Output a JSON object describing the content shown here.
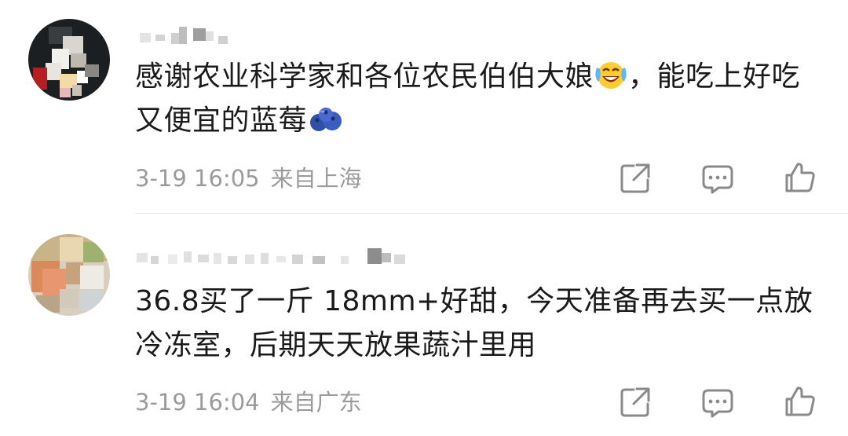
{
  "comments": [
    {
      "text_before_emoji": "感谢农业科学家和各位农民伯伯大娘",
      "emoji_1": "crying-laughing-emoji",
      "text_after_emoji": "，能吃上好吃又便宜的蓝莓",
      "emoji_2": "blueberry-emoji",
      "time": "3-19 16:05",
      "location": "来自上海"
    },
    {
      "text_before_emoji": "36.8买了一斤 18mm+好甜，今天准备再去买一点放冷冻室，后期天天放果蔬汁里用",
      "time": "3-19 16:04",
      "location": "来自广东"
    }
  ],
  "icons": {
    "share": "share-icon",
    "comment": "comment-icon",
    "like": "thumbs-up-icon"
  },
  "colors": {
    "text": "#1a1a1a",
    "meta": "#9b9b9b",
    "icon": "#8a8a8a",
    "divider": "#e6e6e6"
  }
}
